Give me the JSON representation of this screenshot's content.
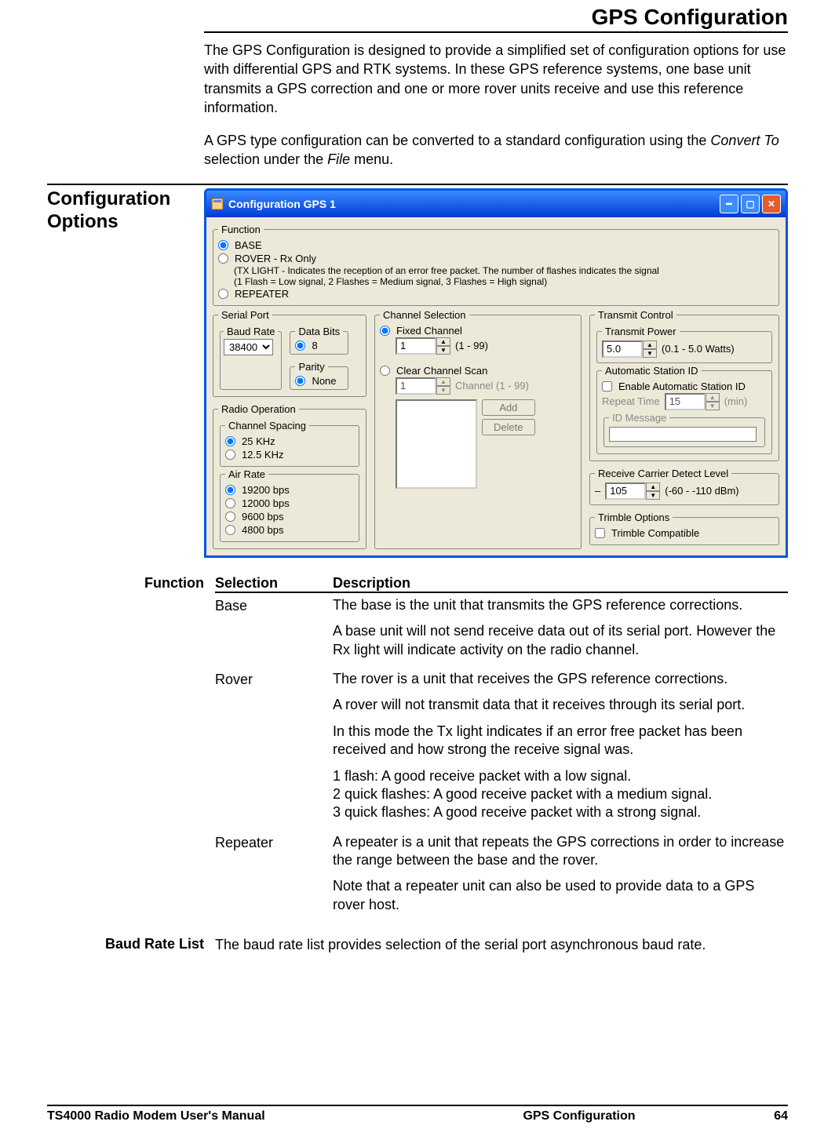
{
  "title": "GPS Configuration",
  "intro_p1": "The GPS Configuration is designed to provide a simplified set of configuration options for use with differential GPS and RTK systems.  In these GPS reference systems, one base unit transmits a GPS correction and one or more rover units receive and use this reference information.",
  "intro_p2_a": "A GPS type configuration can be converted to a standard configuration using the ",
  "intro_p2_i1": "Convert To",
  "intro_p2_b": " selection under the ",
  "intro_p2_i2": "File",
  "intro_p2_c": " menu.",
  "side_heading": "Configuration Options",
  "win": {
    "title": "Configuration GPS 1",
    "function": {
      "legend": "Function",
      "base": "BASE",
      "rover": "ROVER - Rx Only",
      "rover_sub1": "(TX LIGHT - Indicates the reception of an error free packet.  The number of flashes indicates the signal",
      "rover_sub2": "(1 Flash = Low signal, 2 Flashes = Medium signal, 3 Flashes = High signal)",
      "repeater": "REPEATER"
    },
    "serial": {
      "legend": "Serial Port",
      "baud_legend": "Baud Rate",
      "baud_value": "38400",
      "databits_legend": "Data Bits",
      "databits_8": "8",
      "parity_legend": "Parity",
      "parity_none": "None"
    },
    "radio_op": {
      "legend": "Radio Operation",
      "spacing_legend": "Channel Spacing",
      "spacing_25": "25 KHz",
      "spacing_125": "12.5 KHz",
      "air_legend": "Air Rate",
      "air_19200": "19200 bps",
      "air_12000": "12000 bps",
      "air_9600": "9600 bps",
      "air_4800": "4800 bps"
    },
    "channel": {
      "legend": "Channel Selection",
      "fixed": "Fixed Channel",
      "fixed_range": "(1 - 99)",
      "fixed_value": "1",
      "clear": "Clear Channel Scan",
      "clear_value": "1",
      "clear_range": "Channel (1 - 99)",
      "add": "Add",
      "delete": "Delete"
    },
    "tx": {
      "legend": "Transmit Control",
      "power_legend": "Transmit Power",
      "power_value": "5.0",
      "power_range": "(0.1 - 5.0 Watts)",
      "auto_legend": "Automatic Station ID",
      "auto_chk": "Enable Automatic Station ID",
      "repeat_label": "Repeat Time",
      "repeat_value": "15",
      "repeat_unit": "(min)",
      "idmsg_legend": "ID Message",
      "idmsg_value": ""
    },
    "rcd": {
      "legend": "Receive Carrier Detect Level",
      "prefix": "–",
      "value": "105",
      "range": "(-60 - -110 dBm)"
    },
    "trimble": {
      "legend": "Trimble Options",
      "chk": "Trimble Compatible"
    }
  },
  "function_section": {
    "heading": "Function",
    "col1": "Selection",
    "col2": "Description",
    "rows": [
      {
        "sel": "Base",
        "paras": [
          "The base is the unit that transmits the GPS reference corrections.",
          "A base unit will not send receive data out of its serial port. However the Rx light will indicate activity on the radio channel."
        ]
      },
      {
        "sel": "Rover",
        "paras": [
          "The rover is a unit that receives the GPS reference corrections.",
          "A rover will not transmit data that it receives through its serial port.",
          "In this mode the Tx light indicates if an error free packet has been received and how strong the receive signal was.",
          "1 flash: A good receive packet with a low signal.\n2 quick flashes: A good receive packet with a medium signal.\n3 quick flashes: A good receive packet with a strong signal."
        ]
      },
      {
        "sel": "Repeater",
        "paras": [
          "A repeater is a unit that repeats the GPS corrections in order to increase the range between the base and the rover.",
          "Note that a repeater unit can also be used to provide data to a GPS rover host."
        ]
      }
    ]
  },
  "baud_section": {
    "heading": "Baud Rate List",
    "text": "The baud rate list provides selection of the serial port asynchronous baud rate."
  },
  "footer": {
    "left": "TS4000 Radio Modem User's Manual",
    "center": "GPS Configuration",
    "right": "64"
  }
}
